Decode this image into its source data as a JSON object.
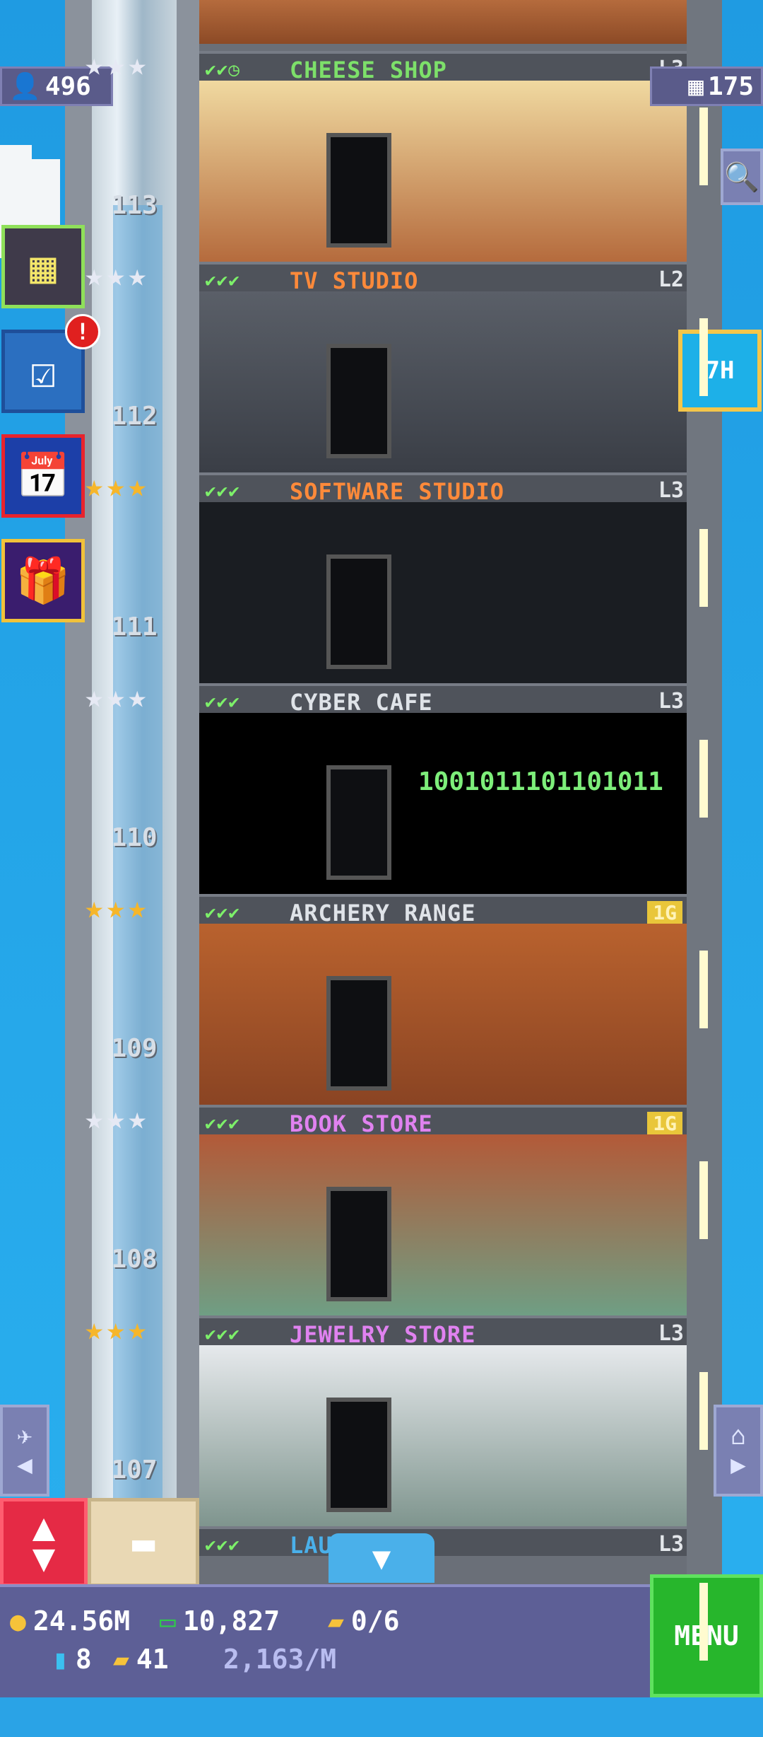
{
  "top_left_chip": {
    "icon": "person-icon",
    "value": "496"
  },
  "top_right_chip": {
    "icon": "building-icon",
    "value": "175"
  },
  "timer_button": {
    "label": "7H"
  },
  "side_buttons": [
    {
      "name": "build-floor",
      "icon": "building-icon"
    },
    {
      "name": "missions",
      "icon": "checklist-icon",
      "badge": "!"
    },
    {
      "name": "calendar",
      "icon": "calendar-icon"
    },
    {
      "name": "gifts",
      "icon": "gift-icon"
    }
  ],
  "floors": [
    {
      "number": "",
      "name": "CHEESE SHOP",
      "level": "L3",
      "checks": "✔✔◷",
      "stars": "★★★",
      "name_color": "#7de06a",
      "room": "room-cheese"
    },
    {
      "number": "113",
      "name": "TV STUDIO",
      "level": "L2",
      "checks": "✔✔✔",
      "stars": "★★★",
      "name_color": "#ff8a3a",
      "room": "room-tv"
    },
    {
      "number": "112",
      "name": "SOFTWARE STUDIO",
      "level": "L3",
      "checks": "✔✔✔",
      "stars": "★★★",
      "name_color": "#ff8a3a",
      "room": "room-soft"
    },
    {
      "number": "111",
      "name": "CYBER CAFE",
      "level": "L3",
      "checks": "✔✔✔",
      "stars": "★★★",
      "name_color": "#dfe3e8",
      "room": "room-cyber"
    },
    {
      "number": "110",
      "name": "ARCHERY RANGE",
      "level": "1G",
      "checks": "✔✔✔",
      "stars": "★★★",
      "name_color": "#dfe3e8",
      "room": "room-archery"
    },
    {
      "number": "109",
      "name": "BOOK STORE",
      "level": "1G",
      "checks": "✔✔✔",
      "stars": "★★★",
      "name_color": "#e082f0",
      "room": "room-book"
    },
    {
      "number": "108",
      "name": "JEWELRY STORE",
      "level": "L3",
      "checks": "✔✔✔",
      "stars": "★★★",
      "name_color": "#e082f0",
      "room": "room-jewel"
    },
    {
      "number": "107",
      "name": "LAUNDROMAT",
      "level": "L3",
      "checks": "✔✔✔",
      "stars": "",
      "name_color": "#4ab0ea",
      "room": "room-laundry"
    }
  ],
  "binary_text": "1001011101101011",
  "hud": {
    "coins": "24.56M",
    "bux": "10,827",
    "tickets": "0/6",
    "keys": "8",
    "vip": "41",
    "rate": "2,163/M",
    "menu_label": "MENU"
  },
  "colors": {
    "sky": "#2aa3e6",
    "hud": "#5d5f96",
    "menu": "#27b62c",
    "gold_level": "#e9c63a"
  }
}
